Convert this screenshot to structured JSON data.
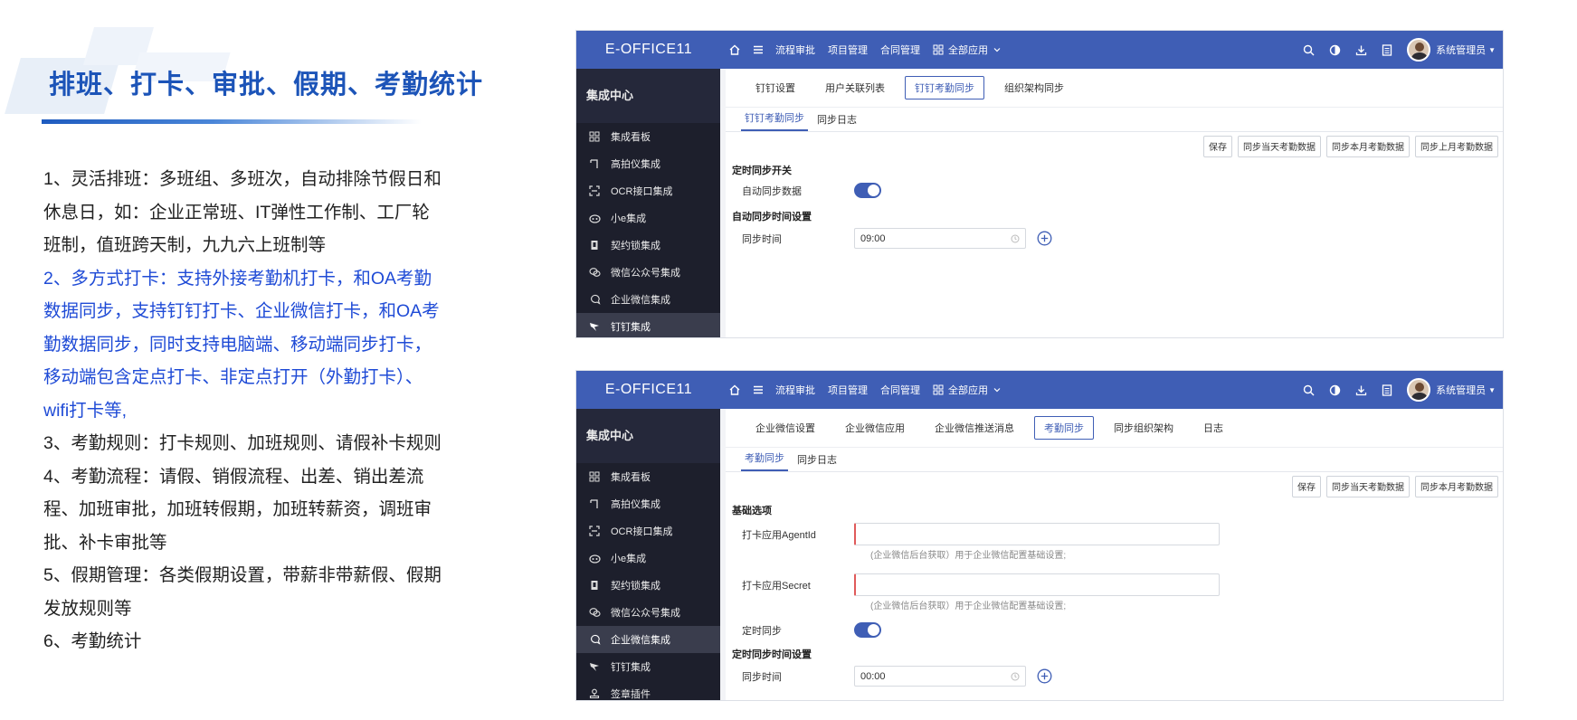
{
  "slide": {
    "title": "排班、打卡、审批、假期、考勤统计",
    "points": [
      {
        "text": "1、灵活排班：多班组、多班次，自动排除节假日和休息日，如：企业正常班、IT弹性工作制、工厂轮班制，值班跨天制，九九六上班制等",
        "highlight": false
      },
      {
        "text": "2、多方式打卡：支持外接考勤机打卡，和OA考勤数据同步，支持钉钉打卡、企业微信打卡，和OA考勤数据同步，同时支持电脑端、移动端同步打卡，移动端包含定点打卡、非定点打开（外勤打卡）、wifi打卡等,",
        "highlight": true
      },
      {
        "text": "3、考勤规则：打卡规则、加班规则、请假补卡规则",
        "highlight": false
      },
      {
        "text": "4、考勤流程：请假、销假流程、出差、销出差流程、加班审批，加班转假期，加班转薪资，调班审批、补卡审批等",
        "highlight": false
      },
      {
        "text": "5、假期管理：各类假期设置，带薪非带薪假、假期发放规则等",
        "highlight": false
      },
      {
        "text": "6、考勤统计",
        "highlight": false
      }
    ]
  },
  "app": {
    "brand": "E-OFFICE11",
    "nav": [
      "流程审批",
      "项目管理",
      "合同管理"
    ],
    "all_apps": "全部应用",
    "user": "系统管理员",
    "sidebar_title": "集成中心",
    "colors": {
      "primary": "#3f5eb5",
      "sidebar": "#1d1f2c"
    }
  },
  "window1": {
    "sidebar": [
      {
        "label": "集成看板",
        "icon": "grid-icon"
      },
      {
        "label": "高拍仪集成",
        "icon": "camera-icon"
      },
      {
        "label": "OCR接口集成",
        "icon": "scan-icon"
      },
      {
        "label": "小e集成",
        "icon": "robot-icon"
      },
      {
        "label": "契约锁集成",
        "icon": "lock-icon"
      },
      {
        "label": "微信公众号集成",
        "icon": "wechat-icon"
      },
      {
        "label": "企业微信集成",
        "icon": "chat-icon"
      },
      {
        "label": "钉钉集成",
        "icon": "dingtalk-icon",
        "active": true
      }
    ],
    "tabs": [
      "钉钉设置",
      "用户关联列表",
      "钉钉考勤同步",
      "组织架构同步"
    ],
    "subtabs": [
      "钉钉考勤同步",
      "同步日志"
    ],
    "buttons": [
      "保存",
      "同步当天考勤数据",
      "同步本月考勤数据",
      "同步上月考勤数据"
    ],
    "section1": "定时同步开关",
    "auto_sync_label": "自动同步数据",
    "auto_sync_on": true,
    "section2": "自动同步时间设置",
    "time_label": "同步时间",
    "time_value": "09:00"
  },
  "window2": {
    "sidebar": [
      {
        "label": "集成看板",
        "icon": "grid-icon"
      },
      {
        "label": "高拍仪集成",
        "icon": "camera-icon"
      },
      {
        "label": "OCR接口集成",
        "icon": "scan-icon"
      },
      {
        "label": "小e集成",
        "icon": "robot-icon"
      },
      {
        "label": "契约锁集成",
        "icon": "lock-icon"
      },
      {
        "label": "微信公众号集成",
        "icon": "wechat-icon"
      },
      {
        "label": "企业微信集成",
        "icon": "chat-icon",
        "active": true
      },
      {
        "label": "钉钉集成",
        "icon": "dingtalk-icon"
      },
      {
        "label": "签章插件",
        "icon": "stamp-icon"
      }
    ],
    "tabs": [
      "企业微信设置",
      "企业微信应用",
      "企业微信推送消息",
      "考勤同步",
      "同步组织架构",
      "日志"
    ],
    "subtabs": [
      "考勤同步",
      "同步日志"
    ],
    "buttons": [
      "保存",
      "同步当天考勤数据",
      "同步本月考勤数据"
    ],
    "section1": "基础选项",
    "agentid_label": "打卡应用AgentId",
    "agentid_value": "",
    "agentid_hint": "(企业微信后台获取）用于企业微信配置基础设置;",
    "secret_label": "打卡应用Secret",
    "secret_value": "",
    "secret_hint": "(企业微信后台获取）用于企业微信配置基础设置;",
    "timed_sync_label": "定时同步",
    "timed_sync_on": true,
    "section2": "定时同步时间设置",
    "time_label": "同步时间",
    "time_value": "00:00"
  }
}
